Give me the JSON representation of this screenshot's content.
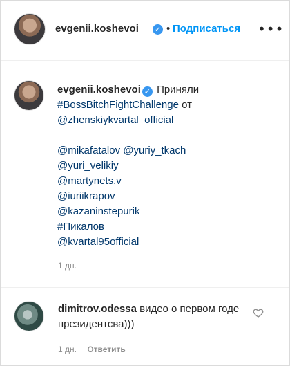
{
  "header": {
    "username": "evgenii.koshevoi",
    "separator": "•",
    "follow_label": "Подписаться",
    "more_label": "•••"
  },
  "caption": {
    "username": "evgenii.koshevoi",
    "text_first": "Приняли",
    "hashtag": "#BossBitchFightChallenge",
    "from_word": "от",
    "from_mention": "@zhenskiykvartal_official",
    "mentions": [
      "@mikafatalov",
      "@yuriy_tkach",
      "@yuri_velikiy",
      "@martynets.v",
      "@iuriikrapov",
      "@kazaninstepurik",
      "#Пикалов",
      "@kvartal95official"
    ],
    "time": "1 дн."
  },
  "comment": {
    "username": "dimitrov.odessa",
    "text": "видео о первом годе президентсва)))",
    "time": "1 дн.",
    "reply_label": "Ответить"
  },
  "icons": {
    "verified": "verified-badge-icon",
    "heart": "heart-outline-icon",
    "more": "more-horizontal-icon"
  },
  "colors": {
    "link": "#00376b",
    "follow": "#0095f6",
    "verified": "#3897f0",
    "muted": "#8e8e8e"
  }
}
